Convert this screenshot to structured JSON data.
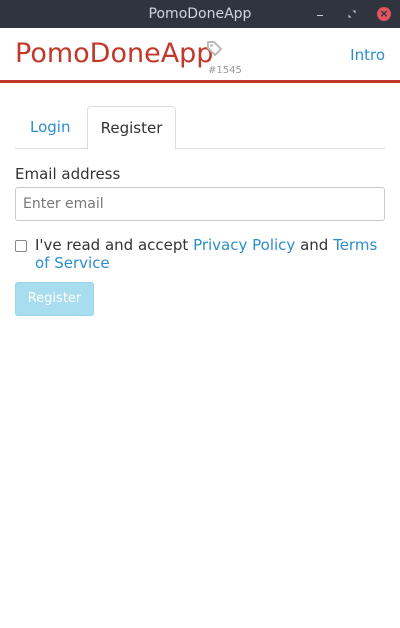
{
  "window": {
    "title": "PomoDoneApp",
    "buttons": {
      "minimize_icon": "minimize-icon",
      "maximize_icon": "restore-icon",
      "close_icon": "close-icon"
    }
  },
  "header": {
    "brand": "PomoDoneApp",
    "build": "#1545",
    "tag_icon": "tag-icon",
    "intro_link": "Intro",
    "accent_color": "#c0392b"
  },
  "tabs": [
    {
      "label": "Login",
      "active": false
    },
    {
      "label": "Register",
      "active": true
    }
  ],
  "form": {
    "email_label": "Email address",
    "email_value": "",
    "email_placeholder": "Enter email",
    "agree_checked": false,
    "agree_prefix": "I've read and accept",
    "privacy_link": "Privacy Policy",
    "agree_and": "and",
    "terms_link": "Terms of Service",
    "submit_label": "Register",
    "submit_disabled": true
  },
  "colors": {
    "link": "#2c8dcc",
    "button_disabled": "#a8dcef"
  }
}
